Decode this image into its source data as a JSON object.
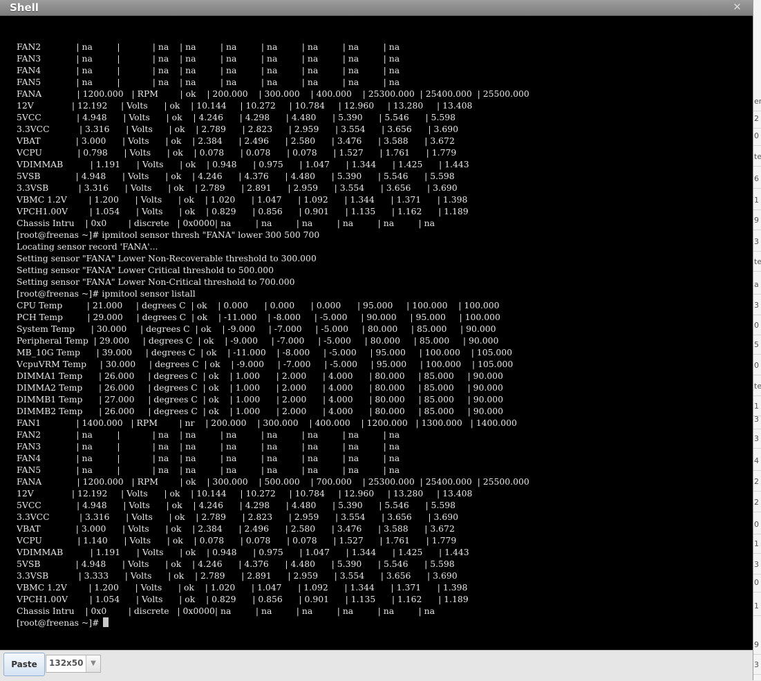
{
  "window": {
    "title": "Shell",
    "close_icon": "✕"
  },
  "terminal": {
    "lines": [
      "FAN2             | na         |            | na    | na         | na         | na         | na         | na         | na",
      "FAN3             | na         |            | na    | na         | na         | na         | na         | na         | na",
      "FAN4             | na         |            | na    | na         | na         | na         | na         | na         | na",
      "FAN5             | na         |            | na    | na         | na         | na         | na         | na         | na",
      "FANA             | 1200.000   | RPM        | ok    | 200.000    | 300.000    | 400.000    | 25300.000  | 25400.000  | 25500.000",
      "12V              | 12.192     | Volts      | ok    | 10.144     | 10.272     | 10.784     | 12.960     | 13.280     | 13.408",
      "5VCC             | 4.948      | Volts      | ok    | 4.246      | 4.298      | 4.480      | 5.390      | 5.546      | 5.598",
      "3.3VCC           | 3.316      | Volts      | ok    | 2.789      | 2.823      | 2.959      | 3.554      | 3.656      | 3.690",
      "VBAT             | 3.000      | Volts      | ok    | 2.384      | 2.496      | 2.580      | 3.476      | 3.588      | 3.672",
      "VCPU             | 0.798      | Volts      | ok    | 0.078      | 0.078      | 0.078      | 1.527      | 1.761      | 1.779",
      "VDIMMAB          | 1.191      | Volts      | ok    | 0.948      | 0.975      | 1.047      | 1.344      | 1.425      | 1.443",
      "5VSB             | 4.948      | Volts      | ok    | 4.246      | 4.376      | 4.480      | 5.390      | 5.546      | 5.598",
      "3.3VSB           | 3.316      | Volts      | ok    | 2.789      | 2.891      | 2.959      | 3.554      | 3.656      | 3.690",
      "VBMC 1.2V        | 1.200      | Volts      | ok    | 1.020      | 1.047      | 1.092      | 1.344      | 1.371      | 1.398",
      "VPCH1.00V        | 1.054      | Volts      | ok    | 0.829      | 0.856      | 0.901      | 1.135      | 1.162      | 1.189",
      "Chassis Intru    | 0x0        | discrete   | 0x0000| na         | na         | na         | na         | na         | na",
      "[root@freenas ~]# ipmitool sensor thresh \"FANA\" lower 300 500 700",
      "Locating sensor record 'FANA'...",
      "Setting sensor \"FANA\" Lower Non-Recoverable threshold to 300.000",
      "Setting sensor \"FANA\" Lower Critical threshold to 500.000",
      "Setting sensor \"FANA\" Lower Non-Critical threshold to 700.000",
      "[root@freenas ~]# ipmitool sensor listall",
      "CPU Temp         | 21.000     | degrees C  | ok    | 0.000      | 0.000      | 0.000      | 95.000     | 100.000    | 100.000",
      "PCH Temp         | 29.000     | degrees C  | ok    | -11.000    | -8.000     | -5.000     | 90.000     | 95.000     | 100.000",
      "System Temp      | 30.000     | degrees C  | ok    | -9.000     | -7.000     | -5.000     | 80.000     | 85.000     | 90.000",
      "Peripheral Temp  | 29.000     | degrees C  | ok    | -9.000     | -7.000     | -5.000     | 80.000     | 85.000     | 90.000",
      "MB_10G Temp      | 39.000     | degrees C  | ok    | -11.000    | -8.000     | -5.000     | 95.000     | 100.000    | 105.000",
      "VcpuVRM Temp     | 30.000     | degrees C  | ok    | -9.000     | -7.000     | -5.000     | 95.000     | 100.000    | 105.000",
      "DIMMA1 Temp      | 26.000     | degrees C  | ok    | 1.000      | 2.000      | 4.000      | 80.000     | 85.000     | 90.000",
      "DIMMA2 Temp      | 26.000     | degrees C  | ok    | 1.000      | 2.000      | 4.000      | 80.000     | 85.000     | 90.000",
      "DIMMB1 Temp      | 27.000     | degrees C  | ok    | 1.000      | 2.000      | 4.000      | 80.000     | 85.000     | 90.000",
      "DIMMB2 Temp      | 26.000     | degrees C  | ok    | 1.000      | 2.000      | 4.000      | 80.000     | 85.000     | 90.000",
      "FAN1             | 1400.000   | RPM        | nr    | 200.000    | 300.000    | 400.000    | 1200.000   | 1300.000   | 1400.000",
      "FAN2             | na         |            | na    | na         | na         | na         | na         | na         | na",
      "FAN3             | na         |            | na    | na         | na         | na         | na         | na         | na",
      "FAN4             | na         |            | na    | na         | na         | na         | na         | na         | na",
      "FAN5             | na         |            | na    | na         | na         | na         | na         | na         | na",
      "FANA             | 1200.000   | RPM        | ok    | 300.000    | 500.000    | 700.000    | 25300.000  | 25400.000  | 25500.000",
      "12V              | 12.192     | Volts      | ok    | 10.144     | 10.272     | 10.784     | 12.960     | 13.280     | 13.408",
      "5VCC             | 4.948      | Volts      | ok    | 4.246      | 4.298      | 4.480      | 5.390      | 5.546      | 5.598",
      "3.3VCC           | 3.316      | Volts      | ok    | 2.789      | 2.823      | 2.959      | 3.554      | 3.656      | 3.690",
      "VBAT             | 3.000      | Volts      | ok    | 2.384      | 2.496      | 2.580      | 3.476      | 3.588      | 3.672",
      "VCPU             | 1.140      | Volts      | ok    | 0.078      | 0.078      | 0.078      | 1.527      | 1.761      | 1.779",
      "VDIMMAB          | 1.191      | Volts      | ok    | 0.948      | 0.975      | 1.047      | 1.344      | 1.425      | 1.443",
      "5VSB             | 4.948      | Volts      | ok    | 4.246      | 4.376      | 4.480      | 5.390      | 5.546      | 5.598",
      "3.3VSB           | 3.333      | Volts      | ok    | 2.789      | 2.891      | 2.959      | 3.554      | 3.656      | 3.690",
      "VBMC 1.2V        | 1.200      | Volts      | ok    | 1.020      | 1.047      | 1.092      | 1.344      | 1.371      | 1.398",
      "VPCH1.00V        | 1.054      | Volts      | ok    | 0.829      | 0.856      | 0.901      | 1.135      | 1.162      | 1.189",
      "Chassis Intru    | 0x0        | discrete   | 0x0000| na         | na         | na         | na         | na         | na"
    ],
    "prompt": "[root@freenas ~]# "
  },
  "toolbar": {
    "paste_label": "Paste",
    "size_value": "132x50",
    "dropdown_icon": "▼"
  },
  "background_fragments": [
    "er",
    "2",
    "0",
    "te",
    "6",
    "1",
    "9",
    "3",
    "te",
    "a",
    "3",
    "0",
    "5",
    "0",
    "te",
    "1",
    "3",
    "3",
    "4",
    "2",
    "2",
    "0",
    "1",
    "3",
    "0",
    "1",
    "9",
    "3"
  ]
}
